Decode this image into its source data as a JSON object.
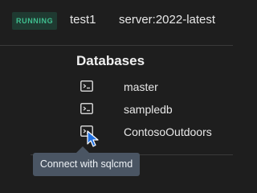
{
  "container": {
    "status": "RUNNING",
    "name": "test1",
    "image": "server:2022-latest"
  },
  "databases": {
    "title": "Databases",
    "items": [
      {
        "label": "master",
        "icon": "terminal-icon"
      },
      {
        "label": "sampledb",
        "icon": "terminal-icon"
      },
      {
        "label": "ContosoOutdoors",
        "icon": "terminal-icon"
      }
    ]
  },
  "tooltip": {
    "text": "Connect with sqlcmd"
  },
  "colors": {
    "background": "#1e1e1e",
    "status_green": "#3fbf8f",
    "tooltip_bg": "#4a5563",
    "cursor_blue": "#1f6fe0"
  }
}
